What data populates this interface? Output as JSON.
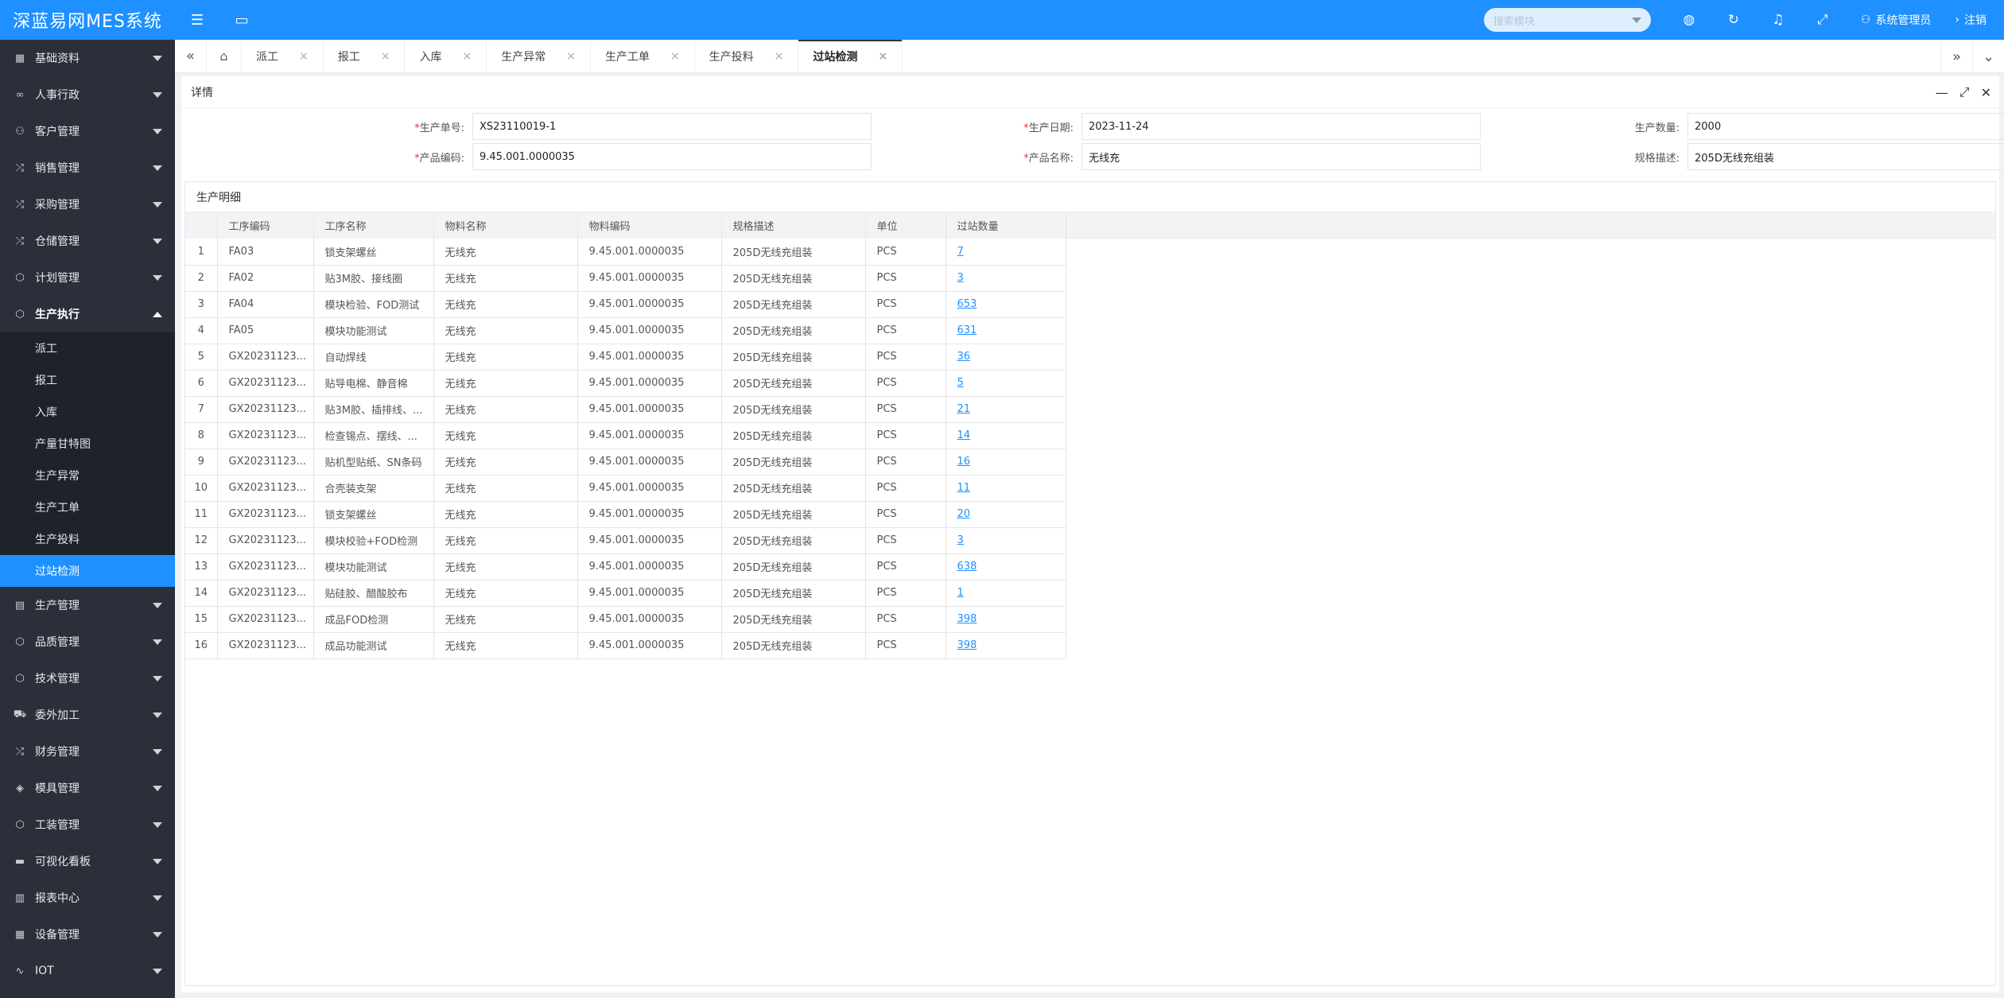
{
  "app": {
    "title": "深蓝易网MES系统"
  },
  "topbar": {
    "search_placeholder": "搜索模块",
    "user": "系统管理员",
    "logout": "注销"
  },
  "sidebar": {
    "items": [
      {
        "label": "基础资料",
        "icon": "grid-icon"
      },
      {
        "label": "人事行政",
        "icon": "link-icon"
      },
      {
        "label": "客户管理",
        "icon": "user-icon"
      },
      {
        "label": "销售管理",
        "icon": "shuffle-icon"
      },
      {
        "label": "采购管理",
        "icon": "shuffle-icon"
      },
      {
        "label": "仓储管理",
        "icon": "shuffle-icon"
      },
      {
        "label": "计划管理",
        "icon": "cube-icon"
      },
      {
        "label": "生产执行",
        "icon": "cube-icon"
      }
    ],
    "sub_items": [
      "派工",
      "报工",
      "入库",
      "产量甘特图",
      "生产异常",
      "生产工单",
      "生产投料",
      "过站检测"
    ],
    "items_after": [
      {
        "label": "生产管理",
        "icon": "doc-icon"
      },
      {
        "label": "品质管理",
        "icon": "cube-icon"
      },
      {
        "label": "技术管理",
        "icon": "cube-icon"
      },
      {
        "label": "委外加工",
        "icon": "truck-icon"
      },
      {
        "label": "财务管理",
        "icon": "shuffle-icon"
      },
      {
        "label": "模具管理",
        "icon": "layers-icon"
      },
      {
        "label": "工装管理",
        "icon": "cube-icon"
      },
      {
        "label": "可视化看板",
        "icon": "chat-icon"
      },
      {
        "label": "报表中心",
        "icon": "table-icon"
      },
      {
        "label": "设备管理",
        "icon": "grid-icon"
      },
      {
        "label": "IOT",
        "icon": "pulse-icon"
      }
    ]
  },
  "tabs": [
    "派工",
    "报工",
    "入库",
    "生产异常",
    "生产工单",
    "生产投料",
    "过站检测"
  ],
  "panel": {
    "title": "详情",
    "form": {
      "prod_no_label": "生产单号:",
      "prod_no": "XS23110019-1",
      "prod_date_label": "生产日期:",
      "prod_date": "2023-11-24",
      "prod_qty_label": "生产数量:",
      "prod_qty": "2000",
      "product_code_label": "产品编码:",
      "product_code": "9.45.001.0000035",
      "product_name_label": "产品名称:",
      "product_name": "无线充",
      "spec_label": "规格描述:",
      "spec": "205D无线充组装"
    },
    "detail_title": "生产明细",
    "columns": [
      "",
      "工序编码",
      "工序名称",
      "物料名称",
      "物料编码",
      "规格描述",
      "单位",
      "过站数量"
    ],
    "rows": [
      [
        "1",
        "FA03",
        "锁支架螺丝",
        "无线充",
        "9.45.001.0000035",
        "205D无线充组装",
        "PCS",
        "7"
      ],
      [
        "2",
        "FA02",
        "贴3M胶、接线圈",
        "无线充",
        "9.45.001.0000035",
        "205D无线充组装",
        "PCS",
        "3"
      ],
      [
        "3",
        "FA04",
        "模块检验、FOD测试",
        "无线充",
        "9.45.001.0000035",
        "205D无线充组装",
        "PCS",
        "653"
      ],
      [
        "4",
        "FA05",
        "模块功能测试",
        "无线充",
        "9.45.001.0000035",
        "205D无线充组装",
        "PCS",
        "631"
      ],
      [
        "5",
        "GX20231123...",
        "自动焊线",
        "无线充",
        "9.45.001.0000035",
        "205D无线充组装",
        "PCS",
        "36"
      ],
      [
        "6",
        "GX20231123...",
        "贴导电棉、静音棉",
        "无线充",
        "9.45.001.0000035",
        "205D无线充组装",
        "PCS",
        "5"
      ],
      [
        "7",
        "GX20231123...",
        "贴3M胶、插排线、...",
        "无线充",
        "9.45.001.0000035",
        "205D无线充组装",
        "PCS",
        "21"
      ],
      [
        "8",
        "GX20231123...",
        "检查锡点、摆线、...",
        "无线充",
        "9.45.001.0000035",
        "205D无线充组装",
        "PCS",
        "14"
      ],
      [
        "9",
        "GX20231123...",
        "贴机型贴纸、SN条码",
        "无线充",
        "9.45.001.0000035",
        "205D无线充组装",
        "PCS",
        "16"
      ],
      [
        "10",
        "GX20231123...",
        "合壳装支架",
        "无线充",
        "9.45.001.0000035",
        "205D无线充组装",
        "PCS",
        "11"
      ],
      [
        "11",
        "GX20231123...",
        "锁支架螺丝",
        "无线充",
        "9.45.001.0000035",
        "205D无线充组装",
        "PCS",
        "20"
      ],
      [
        "12",
        "GX20231123...",
        "模块校验+FOD检测",
        "无线充",
        "9.45.001.0000035",
        "205D无线充组装",
        "PCS",
        "3"
      ],
      [
        "13",
        "GX20231123...",
        "模块功能测试",
        "无线充",
        "9.45.001.0000035",
        "205D无线充组装",
        "PCS",
        "638"
      ],
      [
        "14",
        "GX20231123...",
        "贴硅胶、醋酸胶布",
        "无线充",
        "9.45.001.0000035",
        "205D无线充组装",
        "PCS",
        "1"
      ],
      [
        "15",
        "GX20231123...",
        "成品FOD检测",
        "无线充",
        "9.45.001.0000035",
        "205D无线充组装",
        "PCS",
        "398"
      ],
      [
        "16",
        "GX20231123...",
        "成品功能测试",
        "无线充",
        "9.45.001.0000035",
        "205D无线充组装",
        "PCS",
        "398"
      ]
    ]
  }
}
